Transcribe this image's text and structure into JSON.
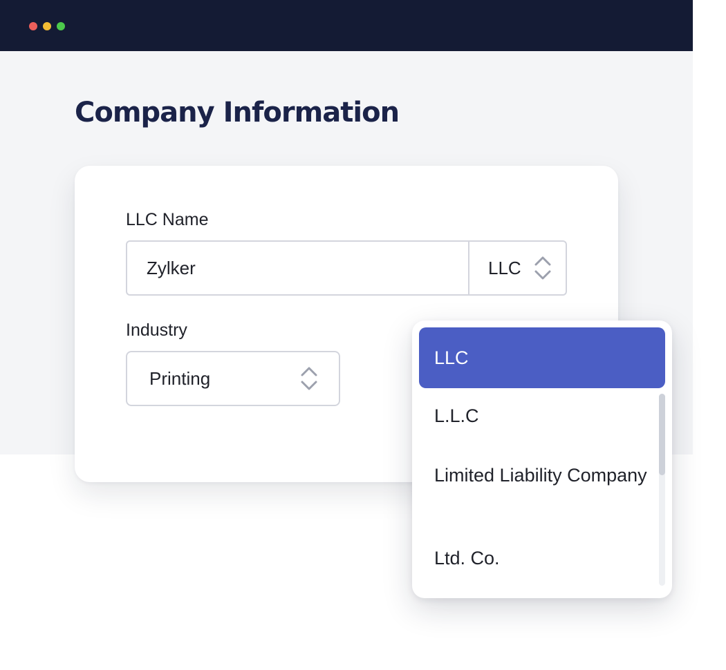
{
  "window": {
    "controls": [
      "close",
      "minimize",
      "maximize"
    ],
    "colors": {
      "titlebar": "#141b34",
      "close": "#ec5f5b",
      "minimize": "#f3bc34",
      "maximize": "#4cc94b"
    }
  },
  "page": {
    "title": "Company Information"
  },
  "form": {
    "llc_name": {
      "label": "LLC Name",
      "value": "Zylker",
      "suffix": "LLC"
    },
    "industry": {
      "label": "Industry",
      "value": "Printing"
    }
  },
  "dropdown": {
    "selected": "LLC",
    "options": [
      "LLC",
      "L.L.C",
      "Limited Liability Company",
      "Ltd. Co."
    ],
    "highlight_color": "#4b5ec4"
  },
  "icons": {
    "select_chevron": "chevron-up-down-icon"
  }
}
